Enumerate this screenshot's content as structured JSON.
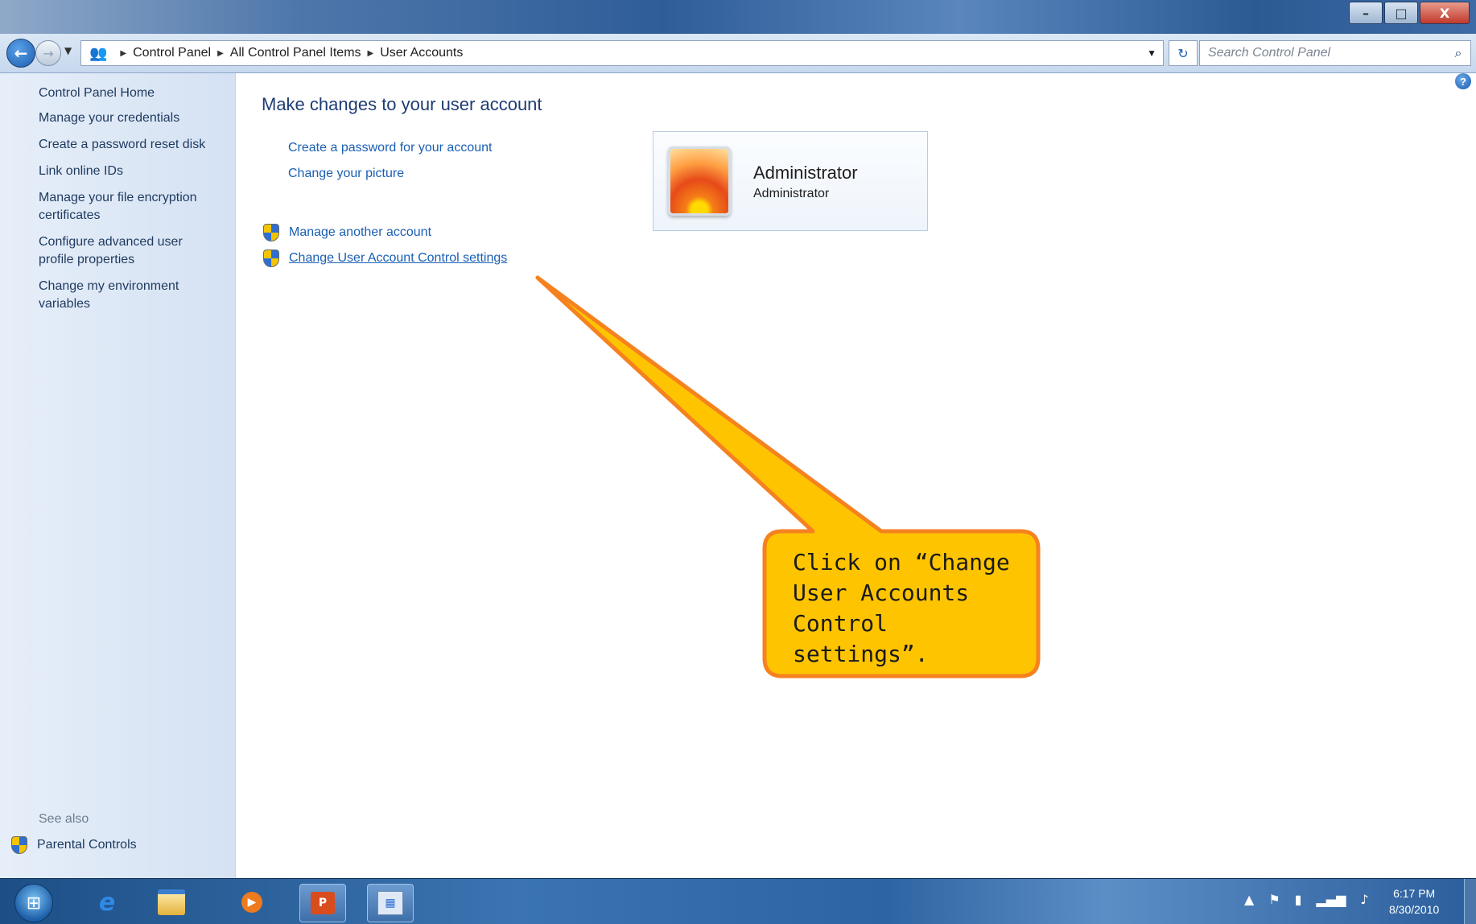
{
  "window": {
    "controls": {
      "minimize": "–",
      "maximize": "□",
      "close": "X"
    }
  },
  "address": {
    "breadcrumbs": [
      "Control Panel",
      "All Control Panel Items",
      "User Accounts"
    ],
    "search_placeholder": "Search Control Panel"
  },
  "sidebar": {
    "home": "Control Panel Home",
    "links": [
      "Manage your credentials",
      "Create a password reset disk",
      "Link online IDs",
      "Manage your file encryption certificates",
      "Configure advanced user profile properties",
      "Change my environment variables"
    ],
    "see_also": "See also",
    "parental_controls": "Parental Controls"
  },
  "main": {
    "heading": "Make changes to your user account",
    "tasks": [
      "Create a password for your account",
      "Change your picture"
    ],
    "shield_tasks": [
      "Manage another account",
      "Change User Account Control settings"
    ],
    "account": {
      "name": "Administrator",
      "role": "Administrator"
    }
  },
  "callout": {
    "text": "Click on “Change User Accounts Control settings”.",
    "fill": "#ffc400",
    "stroke": "#f5821f"
  },
  "taskbar": {
    "time": "6:17 PM",
    "date": "8/30/2010"
  },
  "icons": [
    "back-arrow-icon",
    "forward-arrow-icon",
    "user-accounts-icon",
    "refresh-icon",
    "search-icon",
    "help-icon",
    "shield-icon",
    "windows-start-icon",
    "internet-explorer-icon",
    "explorer-folder-icon",
    "media-player-icon",
    "powerpoint-icon",
    "control-panel-icon",
    "flag-icon",
    "network-icon",
    "volume-icon"
  ]
}
